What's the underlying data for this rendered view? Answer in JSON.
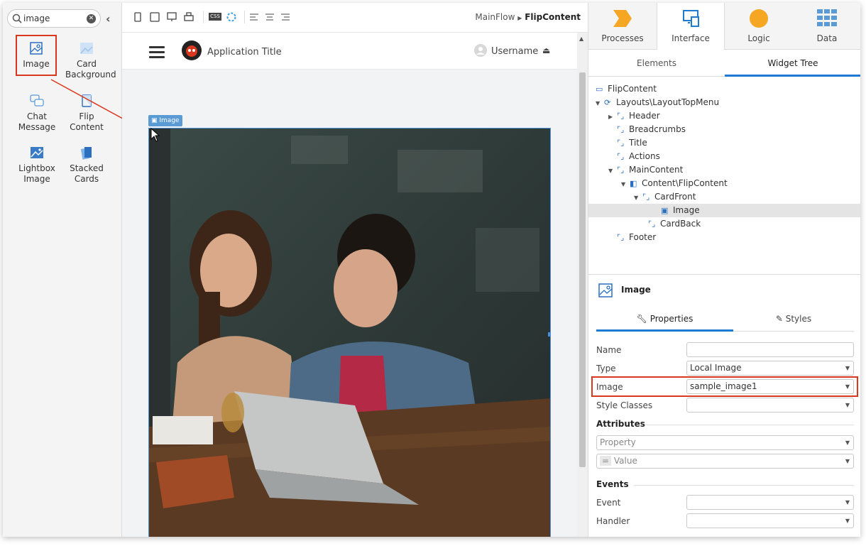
{
  "toolbox": {
    "search_value": "image",
    "widgets": [
      {
        "label": "Image"
      },
      {
        "label": "Card Background"
      },
      {
        "label": "Chat Message"
      },
      {
        "label": "Flip Content"
      },
      {
        "label": "Lightbox Image"
      },
      {
        "label": "Stacked Cards"
      }
    ]
  },
  "canvas": {
    "breadcrumb_flow": "MainFlow",
    "breadcrumb_screen": "FlipContent",
    "app_title": "Application Title",
    "username": "Username",
    "image_tag": "Image"
  },
  "right_panel": {
    "layer_tabs": [
      {
        "label": "Processes"
      },
      {
        "label": "Interface"
      },
      {
        "label": "Logic"
      },
      {
        "label": "Data"
      }
    ],
    "sub_tabs": [
      {
        "label": "Elements"
      },
      {
        "label": "Widget Tree"
      }
    ],
    "tree": [
      {
        "label": "FlipContent"
      },
      {
        "label": "Layouts\\LayoutTopMenu"
      },
      {
        "label": "Header"
      },
      {
        "label": "Breadcrumbs"
      },
      {
        "label": "Title"
      },
      {
        "label": "Actions"
      },
      {
        "label": "MainContent"
      },
      {
        "label": "Content\\FlipContent"
      },
      {
        "label": "CardFront"
      },
      {
        "label": "Image"
      },
      {
        "label": "CardBack"
      },
      {
        "label": "Footer"
      }
    ],
    "props": {
      "title": "Image",
      "tab_properties": "Properties",
      "tab_styles": "Styles",
      "name_label": "Name",
      "name_value": "",
      "type_label": "Type",
      "type_value": "Local Image",
      "image_label": "Image",
      "image_value": "sample_image1",
      "style_classes_label": "Style Classes",
      "style_classes_value": "",
      "attributes_header": "Attributes",
      "property_placeholder": "Property",
      "value_placeholder": "Value",
      "events_header": "Events",
      "event_label": "Event",
      "handler_label": "Handler"
    }
  },
  "colors": {
    "accent": "#1f7ad1",
    "highlight": "#d9381e",
    "processes": "#f5a623",
    "logic": "#f5a623"
  }
}
